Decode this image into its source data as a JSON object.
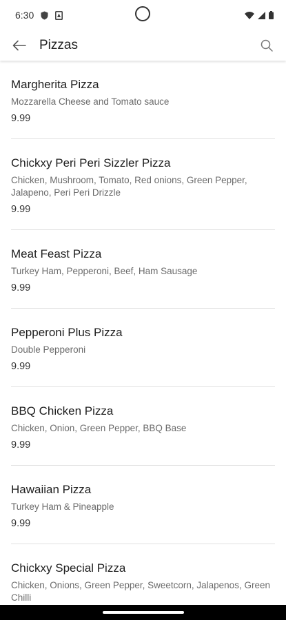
{
  "status_bar": {
    "time": "6:30"
  },
  "app_bar": {
    "title": "Pizzas"
  },
  "items": [
    {
      "name": "Margherita Pizza",
      "description": "Mozzarella Cheese and Tomato sauce",
      "price": "9.99"
    },
    {
      "name": "Chickxy Peri Peri Sizzler Pizza",
      "description": "Chicken, Mushroom, Tomato, Red onions, Green Pepper, Jalapeno, Peri Peri Drizzle",
      "price": "9.99"
    },
    {
      "name": "Meat Feast Pizza",
      "description": "Turkey Ham, Pepperoni, Beef, Ham Sausage",
      "price": "9.99"
    },
    {
      "name": "Pepperoni Plus Pizza",
      "description": "Double Pepperoni",
      "price": "9.99"
    },
    {
      "name": "BBQ Chicken Pizza",
      "description": "Chicken, Onion, Green Pepper, BBQ Base",
      "price": "9.99"
    },
    {
      "name": "Hawaiian Pizza",
      "description": "Turkey Ham & Pineapple",
      "price": "9.99"
    },
    {
      "name": "Chickxy Special Pizza",
      "description": "Chicken, Onions, Green Pepper, Sweetcorn, Jalapenos, Green Chilli",
      "price": ""
    }
  ]
}
